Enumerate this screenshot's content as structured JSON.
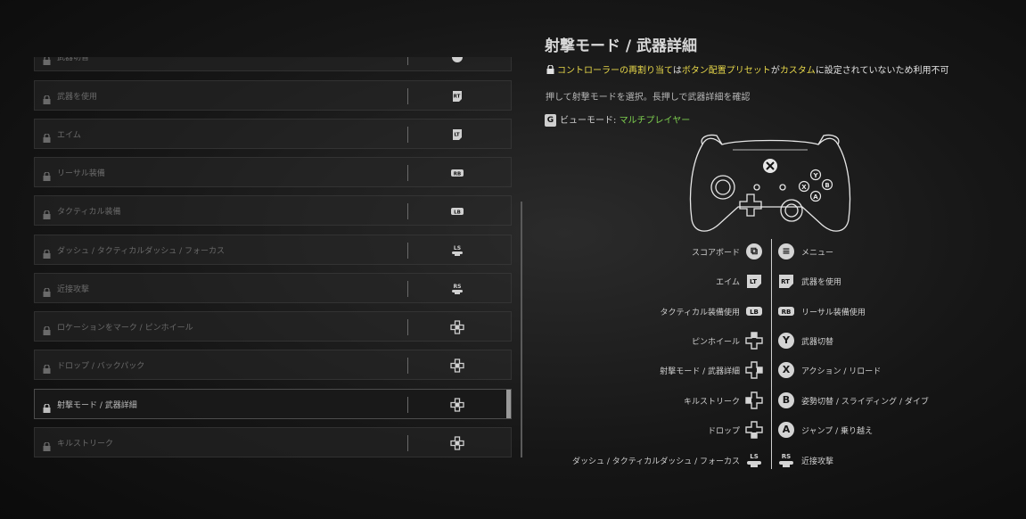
{
  "binding_list": {
    "rows": [
      {
        "label": "武器切替",
        "button_icon": "y-button-icon"
      },
      {
        "label": "武器を使用",
        "button_icon": "rt-icon"
      },
      {
        "label": "エイム",
        "button_icon": "lt-icon"
      },
      {
        "label": "リーサル装備",
        "button_icon": "rb-icon"
      },
      {
        "label": "タクティカル装備",
        "button_icon": "lb-icon"
      },
      {
        "label": "ダッシュ / タクティカルダッシュ / フォーカス",
        "button_icon": "ls-icon"
      },
      {
        "label": "近接攻撃",
        "button_icon": "rs-icon"
      },
      {
        "label": "ロケーションをマーク / ピンホイール",
        "button_icon": "dpad-icon"
      },
      {
        "label": "ドロップ / バックパック",
        "button_icon": "dpad-icon"
      },
      {
        "label": "射撃モード / 武器詳細",
        "button_icon": "dpad-icon",
        "selected": true
      },
      {
        "label": "キルストリーク",
        "button_icon": "dpad-icon"
      }
    ]
  },
  "detail": {
    "title": "射撃モード / 武器詳細",
    "warning": {
      "part1": "コントローラーの再割り当て",
      "part2": "は",
      "part3": "ボタン配置プリセット",
      "part4": "が",
      "part5": "カスタム",
      "part6": "に設定されていないため利用不可"
    },
    "description": "押して射撃モードを選択。長押しで武器詳細を確認",
    "view_mode": {
      "key": "G",
      "label": "ビューモード:",
      "value": "マルチプレイヤー"
    }
  },
  "controller_map": {
    "left": [
      {
        "label": "スコアボード",
        "icon": "view-button-icon",
        "glyph": "⧉"
      },
      {
        "label": "エイム",
        "icon": "lt-icon",
        "glyph": "LT"
      },
      {
        "label": "タクティカル装備使用",
        "icon": "lb-icon",
        "glyph": "LB"
      },
      {
        "label": "ピンホイール",
        "icon": "dpad-up-icon",
        "glyph": "up"
      },
      {
        "label": "射撃モード / 武器詳細",
        "icon": "dpad-right-icon",
        "glyph": "right"
      },
      {
        "label": "キルストリーク",
        "icon": "dpad-left-icon",
        "glyph": "left"
      },
      {
        "label": "ドロップ",
        "icon": "dpad-down-icon",
        "glyph": "down"
      },
      {
        "label": "ダッシュ / タクティカルダッシュ / フォーカス",
        "icon": "ls-icon",
        "glyph": "LS"
      }
    ],
    "right": [
      {
        "label": "メニュー",
        "icon": "menu-button-icon",
        "glyph": "≡"
      },
      {
        "label": "武器を使用",
        "icon": "rt-icon",
        "glyph": "RT"
      },
      {
        "label": "リーサル装備使用",
        "icon": "rb-icon",
        "glyph": "RB"
      },
      {
        "label": "武器切替",
        "icon": "y-button-icon",
        "glyph": "Y"
      },
      {
        "label": "アクション / リロード",
        "icon": "x-button-icon",
        "glyph": "X"
      },
      {
        "label": "姿勢切替 / スライディング / ダイブ",
        "icon": "b-button-icon",
        "glyph": "B"
      },
      {
        "label": "ジャンプ / 乗り越え",
        "icon": "a-button-icon",
        "glyph": "A"
      },
      {
        "label": "近接攻撃",
        "icon": "rs-icon",
        "glyph": "RS"
      }
    ]
  }
}
